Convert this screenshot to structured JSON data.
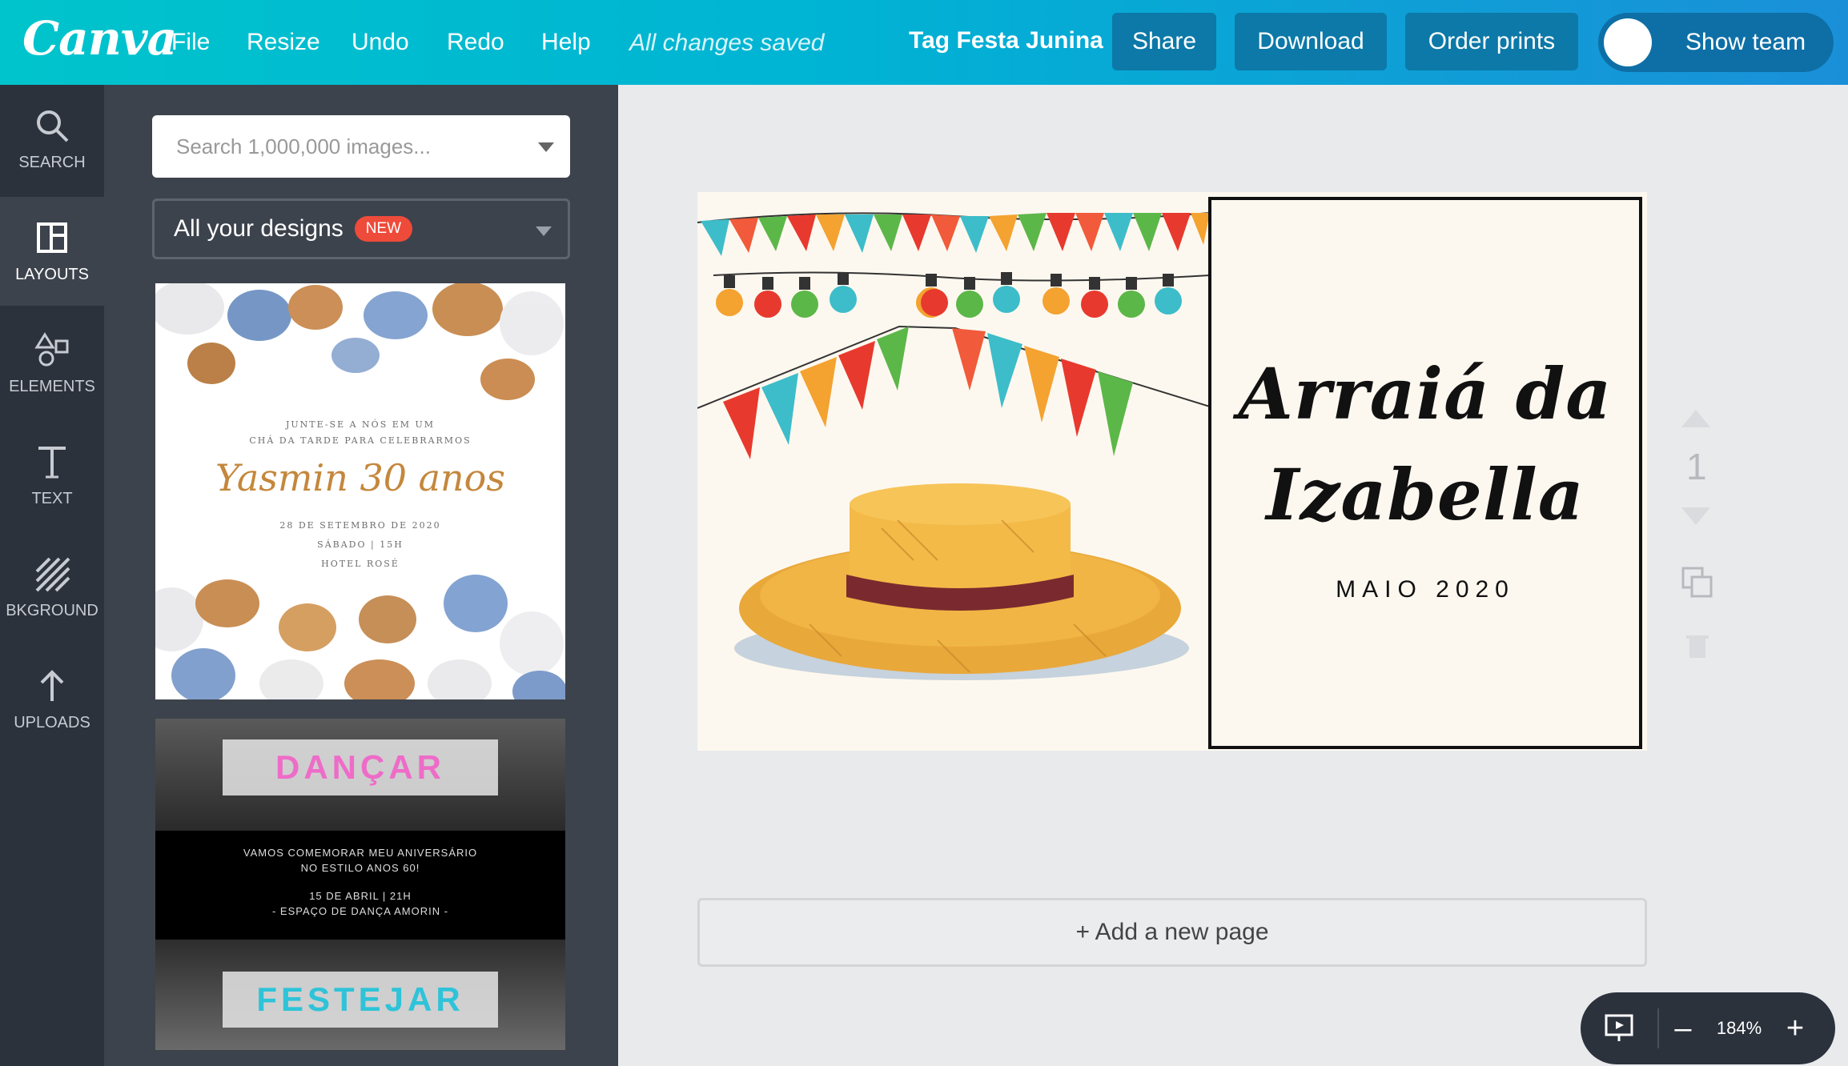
{
  "app": {
    "logo": "Canva",
    "title": "Tag Festa Junina",
    "save_status": "All changes saved"
  },
  "menu": {
    "file": "File",
    "resize": "Resize",
    "undo": "Undo",
    "redo": "Redo",
    "help": "Help"
  },
  "actions": {
    "share": "Share",
    "download": "Download",
    "order_prints": "Order prints",
    "show_team": "Show team"
  },
  "rail": {
    "search": "SEARCH",
    "layouts": "LAYOUTS",
    "elements": "ELEMENTS",
    "text": "TEXT",
    "background": "BKGROUND",
    "uploads": "UPLOADS"
  },
  "panel": {
    "search_placeholder": "Search 1,000,000 images...",
    "designs_dropdown": "All your designs",
    "new_badge": "NEW",
    "template1": {
      "line1": "JUNTE-SE A NÓS EM UM",
      "line2": "CHÁ DA TARDE PARA CELEBRARMOS",
      "name": "Yasmin 30 anos",
      "date": "28 DE SETEMBRO DE 2020",
      "time": "SÁBADO | 15H",
      "place": "HOTEL ROSÉ"
    },
    "template2": {
      "top_word": "DANÇAR",
      "line1": "VAMOS COMEMORAR MEU ANIVERSÁRIO",
      "line2": "NO ESTILO ANOS 60!",
      "line3": "15 DE ABRIL | 21H",
      "line4": "- ESPAÇO DE DANÇA AMORIN -",
      "bottom_word": "FESTEJAR"
    }
  },
  "design": {
    "title_line1": "Arraiá da",
    "title_line2": "Izabella",
    "subtitle": "MAIO 2020"
  },
  "page_tools": {
    "page_number": "1"
  },
  "add_page": "+ Add a new page",
  "zoom": {
    "value": "184%",
    "minus": "–",
    "plus": "+"
  },
  "colors": {
    "brand_gradient_start": "#00c4cc",
    "brand_gradient_end": "#1a8fd8",
    "button_bg": "#0c79a8",
    "rail_bg": "#2c323c",
    "panel_bg": "#3d434d",
    "new_badge": "#ef4b3a",
    "dancar_text": "#ee6cc8",
    "festejar_text": "#2ec3d8",
    "design_bg": "#fdf8ef"
  },
  "icons": {
    "search": "search-icon",
    "layouts": "layouts-icon",
    "elements": "shapes-icon",
    "text": "text-icon",
    "background": "background-pattern-icon",
    "uploads": "upload-arrow-icon",
    "present": "present-icon"
  }
}
